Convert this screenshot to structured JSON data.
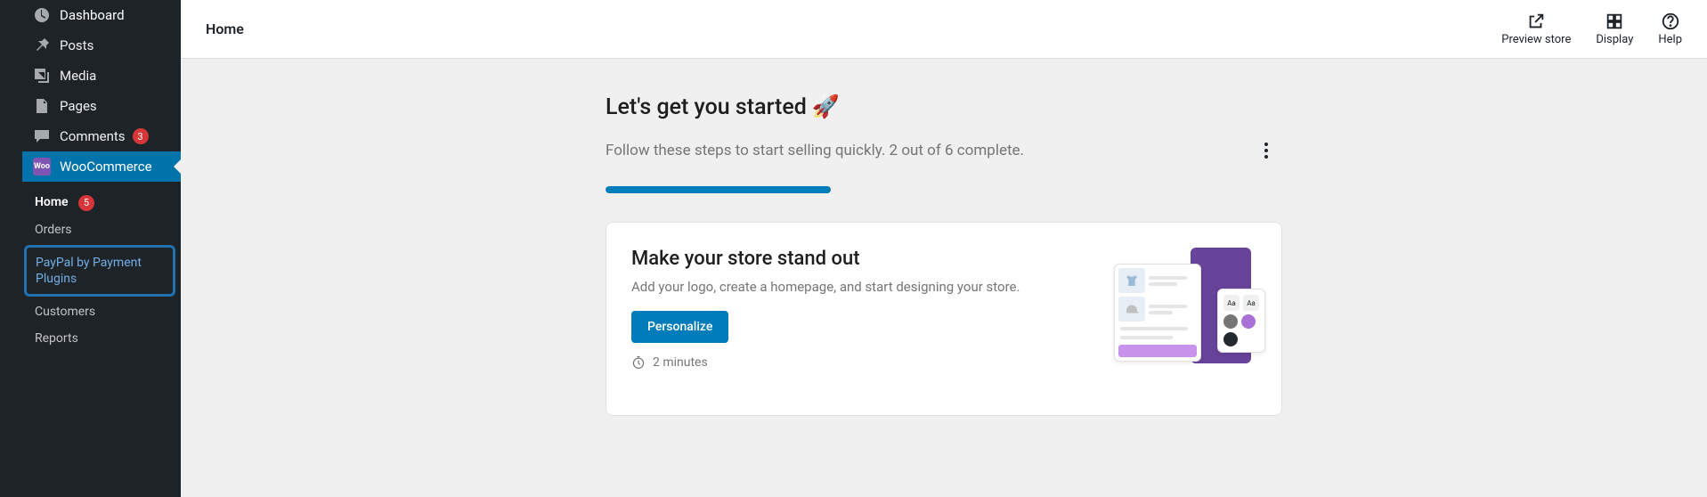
{
  "sidebar": {
    "items": [
      {
        "label": "Dashboard"
      },
      {
        "label": "Posts"
      },
      {
        "label": "Media"
      },
      {
        "label": "Pages"
      },
      {
        "label": "Comments",
        "badge": "3"
      },
      {
        "label": "WooCommerce"
      }
    ],
    "sub": {
      "home": "Home",
      "home_badge": "5",
      "orders": "Orders",
      "paypal": "PayPal by Payment Plugins",
      "customers": "Customers",
      "reports": "Reports"
    }
  },
  "topbar": {
    "title": "Home",
    "preview": "Preview store",
    "display": "Display",
    "help": "Help"
  },
  "onboarding": {
    "heading": "Let's get you started",
    "rocket": "🚀",
    "subhead": "Follow these steps to start selling quickly. 2 out of 6 complete.",
    "progress_pct": 33.3,
    "completed": 2,
    "total": 6
  },
  "card": {
    "title": "Make your store stand out",
    "desc": "Add your logo, create a homepage, and start designing your store.",
    "cta": "Personalize",
    "time": "2 minutes"
  },
  "illo": {
    "aa1": "Aa",
    "aa2": "Aa",
    "dots": [
      "#757575",
      "#a971d6",
      "#24292e"
    ]
  }
}
